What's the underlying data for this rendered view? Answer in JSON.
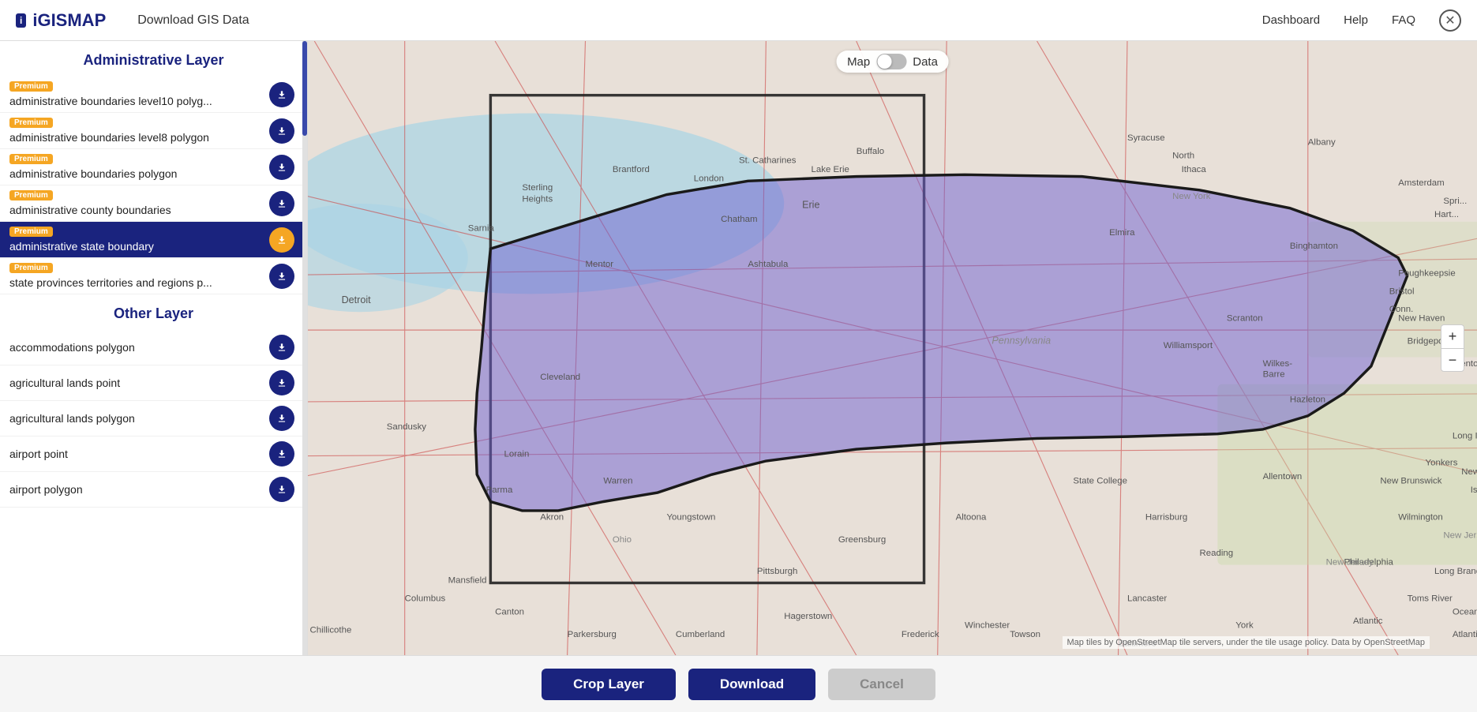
{
  "header": {
    "logo": "iGISMAP",
    "logo_icon": "i",
    "title": "Download GIS Data",
    "nav": {
      "dashboard": "Dashboard",
      "help": "Help",
      "faq": "FAQ"
    }
  },
  "sidebar": {
    "administrative_section": "Administrative Layer",
    "other_section": "Other Layer",
    "admin_layers": [
      {
        "premium": true,
        "name": "administrative boundaries level10 polyg...",
        "active": false
      },
      {
        "premium": true,
        "name": "administrative boundaries level8 polygon",
        "active": false
      },
      {
        "premium": true,
        "name": "administrative boundaries polygon",
        "active": false
      },
      {
        "premium": true,
        "name": "administrative county boundaries",
        "active": false
      },
      {
        "premium": true,
        "name": "administrative state boundary",
        "active": true
      },
      {
        "premium": true,
        "name": "state provinces territories and regions p...",
        "active": false
      }
    ],
    "other_layers": [
      {
        "name": "accommodations polygon",
        "active": false
      },
      {
        "name": "agricultural lands point",
        "active": false
      },
      {
        "name": "agricultural lands polygon",
        "active": false
      },
      {
        "name": "airport point",
        "active": false
      },
      {
        "name": "airport polygon",
        "active": false
      }
    ],
    "premium_label": "Premium"
  },
  "map": {
    "toggle_map": "Map",
    "toggle_data": "Data",
    "attribution": "Map tiles by OpenStreetMap tile servers, under the tile usage policy. Data by OpenStreetMap",
    "zoom_in": "+",
    "zoom_out": "−"
  },
  "bottom_bar": {
    "crop_label": "Crop Layer",
    "download_label": "Download",
    "cancel_label": "Cancel"
  },
  "colors": {
    "primary": "#1a237e",
    "premium_badge": "#f5a623",
    "pa_fill": "rgba(100, 90, 200, 0.55)",
    "pa_border": "#1a1a1a"
  }
}
